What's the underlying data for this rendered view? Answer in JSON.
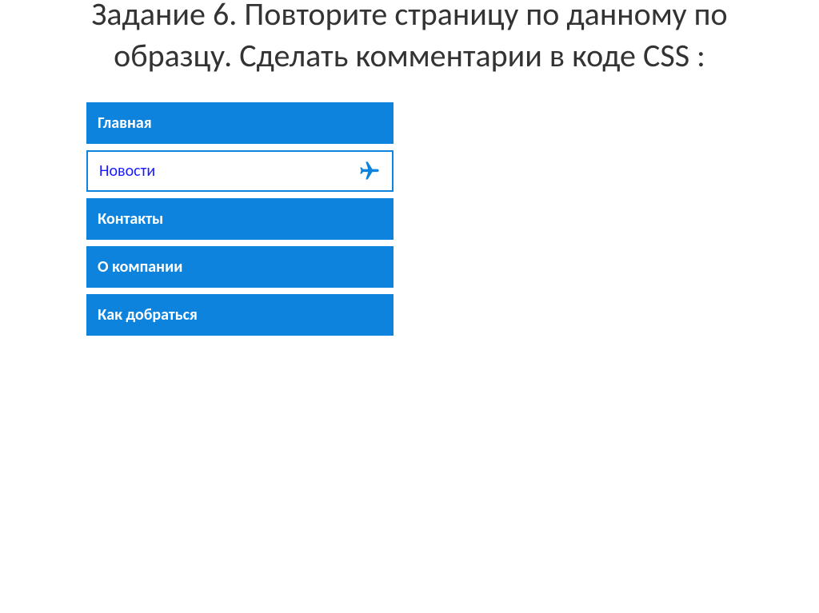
{
  "title": "Задание 6. Повторите страницу по данному по образцу. Сделать комментарии в коде CSS :",
  "menu": {
    "items": [
      {
        "label": "Главная",
        "state": "default"
      },
      {
        "label": "Новости",
        "state": "hover"
      },
      {
        "label": "Контакты",
        "state": "default"
      },
      {
        "label": "О компании",
        "state": "default"
      },
      {
        "label": "Как добраться",
        "state": "default"
      }
    ]
  },
  "colors": {
    "menu_bg": "#0d83dd",
    "menu_text": "#ffffff",
    "hover_bg": "#ffffff",
    "hover_text": "#1a1aff",
    "hover_border": "#0d83dd"
  }
}
